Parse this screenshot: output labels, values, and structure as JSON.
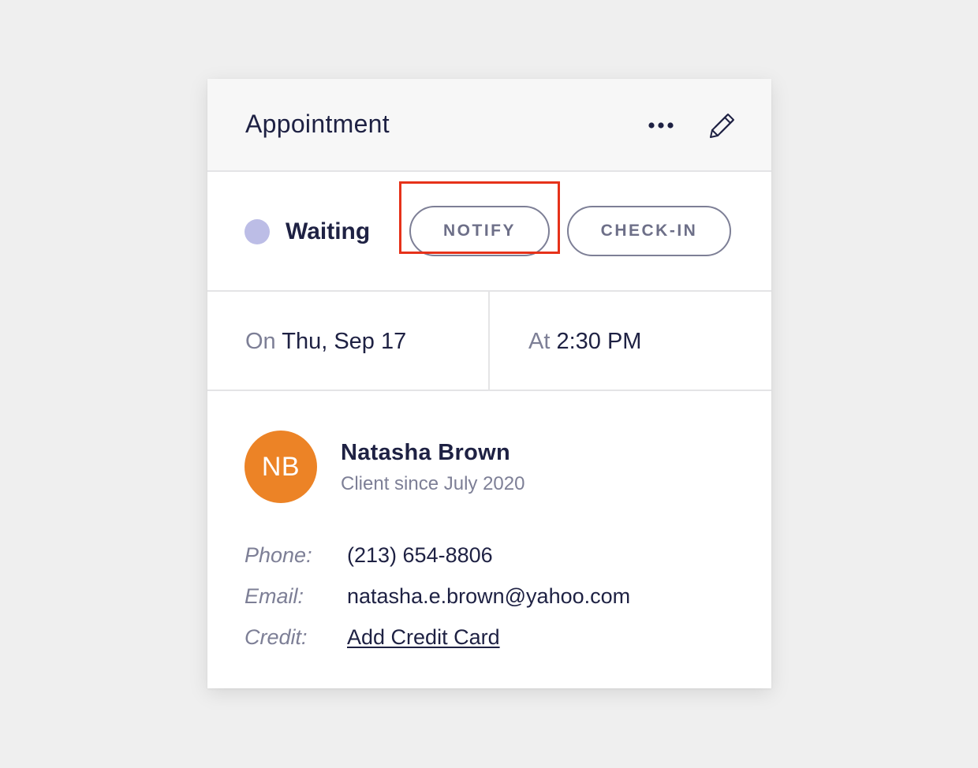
{
  "header": {
    "title": "Appointment",
    "more_icon": "more-horizontal-icon",
    "edit_icon": "pencil-icon"
  },
  "status": {
    "label": "Waiting",
    "dot_color": "#bcbde6",
    "notify_label": "NOTIFY",
    "checkin_label": "CHECK-IN"
  },
  "schedule": {
    "date_prefix": "On",
    "date": "Thu, Sep 17",
    "time_prefix": "At",
    "time": "2:30 PM"
  },
  "client": {
    "initials": "NB",
    "avatar_color": "#ec8326",
    "name": "Natasha Brown",
    "since": "Client since July 2020",
    "phone_label": "Phone:",
    "phone": "(213) 654-8806",
    "email_label": "Email:",
    "email": "natasha.e.brown@yahoo.com",
    "credit_label": "Credit:",
    "credit_link": "Add Credit Card"
  },
  "colors": {
    "highlight": "#e6321a",
    "text_primary": "#1e2143",
    "text_secondary": "#7d7f96"
  }
}
